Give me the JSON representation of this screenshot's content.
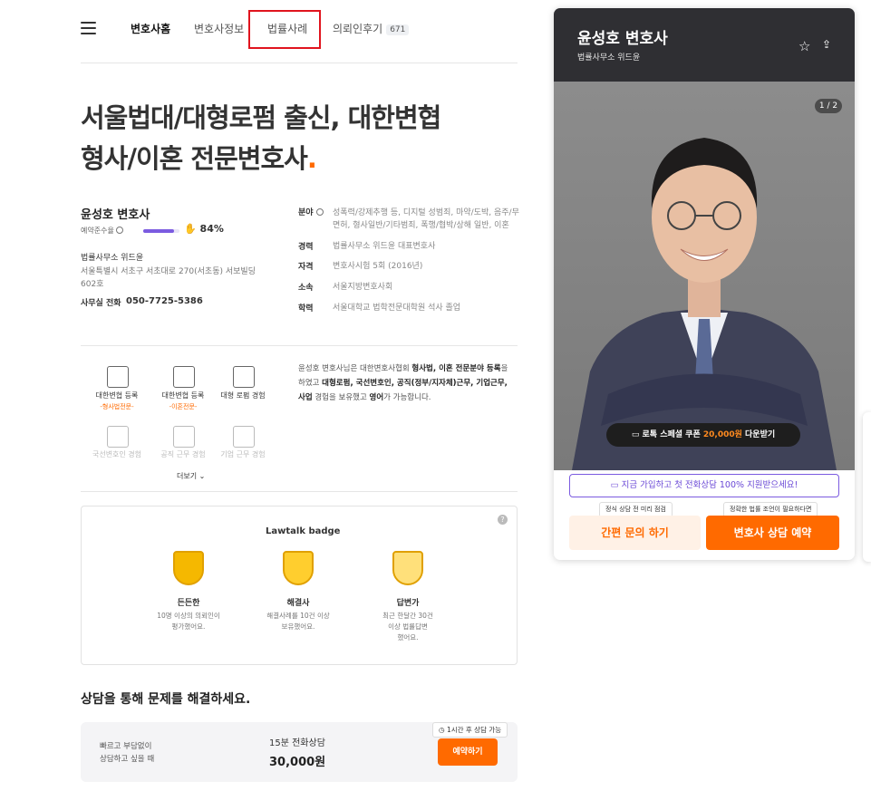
{
  "nav": {
    "items": [
      {
        "label": "변호사홈"
      },
      {
        "label": "변호사정보"
      },
      {
        "label": "법률사례"
      },
      {
        "label": "의뢰인후기",
        "count": "671"
      }
    ]
  },
  "headline": {
    "line1": "서울법대/대형로펌 출신, 대한변협",
    "line2": "형사/이혼 전문변호사",
    "dot": "."
  },
  "profile": {
    "name": "윤성호 변호사",
    "rate_label": "예약준수율",
    "rate_value": "84%",
    "rate_fraction": 0.84,
    "office": "법률사무소 위드윤",
    "address": "서울특별시 서초구 서초대로 270(서초동) 서보빌딩 602호",
    "phone_label": "사무실 전화",
    "phone": "050-7725-5386"
  },
  "info": [
    {
      "key": "분야",
      "value": "성폭력/강제추행 등, 디지털 성범죄, 마약/도박, 음주/무면허, 형사일반/기타범죄, 폭행/협박/상해 일반, 이혼"
    },
    {
      "key": "경력",
      "value": "법률사무소 위드윤 대표변호사"
    },
    {
      "key": "자격",
      "value": "변호사시험 5회 (2016년)"
    },
    {
      "key": "소속",
      "value": "서울지방변호사회"
    },
    {
      "key": "학력",
      "value": "서울대학교 법학전문대학원 석사 졸업"
    }
  ],
  "badges": [
    {
      "label": "대한변협 등록",
      "sub": "-형사법전문-",
      "icon": "certificate-icon"
    },
    {
      "label": "대한변협 등록",
      "sub": "-이혼전문-",
      "icon": "certificate-icon"
    },
    {
      "label": "대형 로펌 경험",
      "icon": "people-icon"
    },
    {
      "label": "국선변호인 경험",
      "icon": "people-icon"
    },
    {
      "label": "공직 근무 경험",
      "icon": "building-icon"
    },
    {
      "label": "기업 근무 경험",
      "icon": "person-desk-icon"
    }
  ],
  "description": {
    "p1": "윤성호 변호사님은 대한변호사협회 ",
    "b1": "형사법, 이혼 전문분야 등록",
    "p2": "을 하였고 ",
    "b2": "대형로펌, 국선변호인, 공직(정부/지자체)근무, 기업근무, 사업",
    "p3": " 경험을 보유했고 ",
    "b3": "영어",
    "p4": "가 가능합니다."
  },
  "more": "더보기",
  "lawtalk": {
    "title": "Lawtalk badge",
    "badges": [
      {
        "name": "든든한",
        "desc1": "10명 이상의 의뢰인이",
        "desc2": "평가했어요."
      },
      {
        "name": "해결사",
        "desc1": "해결사례를 10건 이상",
        "desc2": "보유했어요."
      },
      {
        "name": "답변가",
        "desc1": "최근 한달간 30건",
        "desc2": "이상 법률답변",
        "desc3": "했어요."
      }
    ]
  },
  "consult": {
    "title": "상담을 통해 문제를 해결하세요.",
    "left1": "빠르고 부담없이",
    "left2": "상담하고 싶을 때",
    "type": "15분 전화상담",
    "price": "30,000원",
    "tip": "1시간 후 상담 가능",
    "button": "예약하기"
  },
  "card": {
    "name": "윤성호 변호사",
    "firm": "법률사무소 위드윤",
    "pager": "1 / 2",
    "coupon_a": "로톡 스페셜 쿠폰 ",
    "coupon_b": "20,000원",
    "coupon_c": " 다운받기",
    "promo": "지금 가입하고 첫 전화상담 100% 지원받으세요!",
    "tip_a": "정식 상담 전 미리 점검",
    "tip_b": "정확한 법률 조언이 필요하다면",
    "btn_a": "간편 문의 하기",
    "btn_b": "변호사 상담 예약"
  },
  "colors": {
    "accent": "#ff6a00",
    "purple": "#7b5be0",
    "dark": "#2f2f33",
    "highlight_box": "#e0141e"
  }
}
